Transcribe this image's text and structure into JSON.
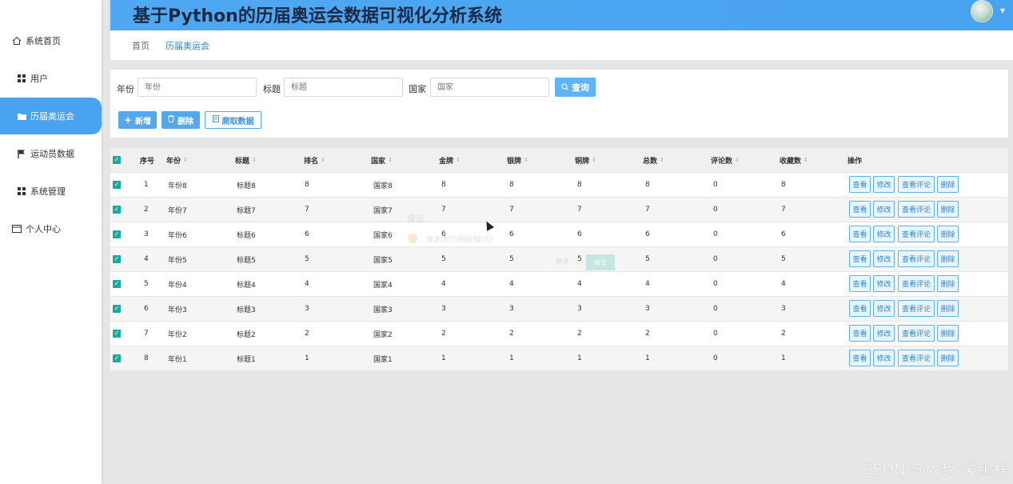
{
  "app": {
    "title": "基于Python的历届奥运会数据可视化分析系统"
  },
  "sidebar": {
    "items": [
      {
        "label": "系统首页",
        "icon": "home-icon"
      },
      {
        "label": "用户",
        "icon": "grid-icon"
      },
      {
        "label": "历届奥运会",
        "icon": "folder-icon"
      },
      {
        "label": "运动员数据",
        "icon": "flag-icon"
      },
      {
        "label": "系统管理",
        "icon": "grid-icon"
      },
      {
        "label": "个人中心",
        "icon": "card-icon"
      }
    ],
    "active_index": 2,
    "accent_color": "#4aa3f0"
  },
  "breadcrumb": {
    "home": "首页",
    "current": "历届奥运会"
  },
  "search": {
    "year_label": "年份",
    "year_placeholder": "年份",
    "title_label": "标题",
    "title_placeholder": "标题",
    "country_label": "国家",
    "country_placeholder": "国家",
    "query_button": "查询"
  },
  "toolbar": {
    "add_label": "新增",
    "delete_label": "删除",
    "crawl_label": "爬取数据"
  },
  "table": {
    "headers": [
      "序号",
      "年份",
      "标题",
      "排名",
      "国家",
      "金牌",
      "银牌",
      "铜牌",
      "总数",
      "评论数",
      "收藏数",
      "操作"
    ],
    "rows": [
      [
        "1",
        "年份8",
        "标题8",
        "8",
        "国家8",
        "8",
        "8",
        "8",
        "8",
        "0",
        "8"
      ],
      [
        "2",
        "年份7",
        "标题7",
        "7",
        "国家7",
        "7",
        "7",
        "7",
        "7",
        "0",
        "7"
      ],
      [
        "3",
        "年份6",
        "标题6",
        "6",
        "国家6",
        "6",
        "6",
        "6",
        "6",
        "0",
        "6"
      ],
      [
        "4",
        "年份5",
        "标题5",
        "5",
        "国家5",
        "5",
        "5",
        "5",
        "5",
        "0",
        "5"
      ],
      [
        "5",
        "年份4",
        "标题4",
        "4",
        "国家4",
        "4",
        "4",
        "4",
        "4",
        "0",
        "4"
      ],
      [
        "6",
        "年份3",
        "标题3",
        "3",
        "国家3",
        "3",
        "3",
        "3",
        "3",
        "0",
        "3"
      ],
      [
        "7",
        "年份2",
        "标题2",
        "2",
        "国家2",
        "2",
        "2",
        "2",
        "2",
        "0",
        "2"
      ],
      [
        "8",
        "年份1",
        "标题1",
        "1",
        "国家1",
        "1",
        "1",
        "1",
        "1",
        "0",
        "1"
      ]
    ],
    "actions": [
      "查看",
      "修改",
      "查看评论",
      "删除"
    ]
  },
  "dialog": {
    "title": "提示",
    "message": "确定进行[删除]操作?",
    "cancel": "取消",
    "confirm": "确定"
  },
  "watermark": "CSDN @大叔_爱编程"
}
